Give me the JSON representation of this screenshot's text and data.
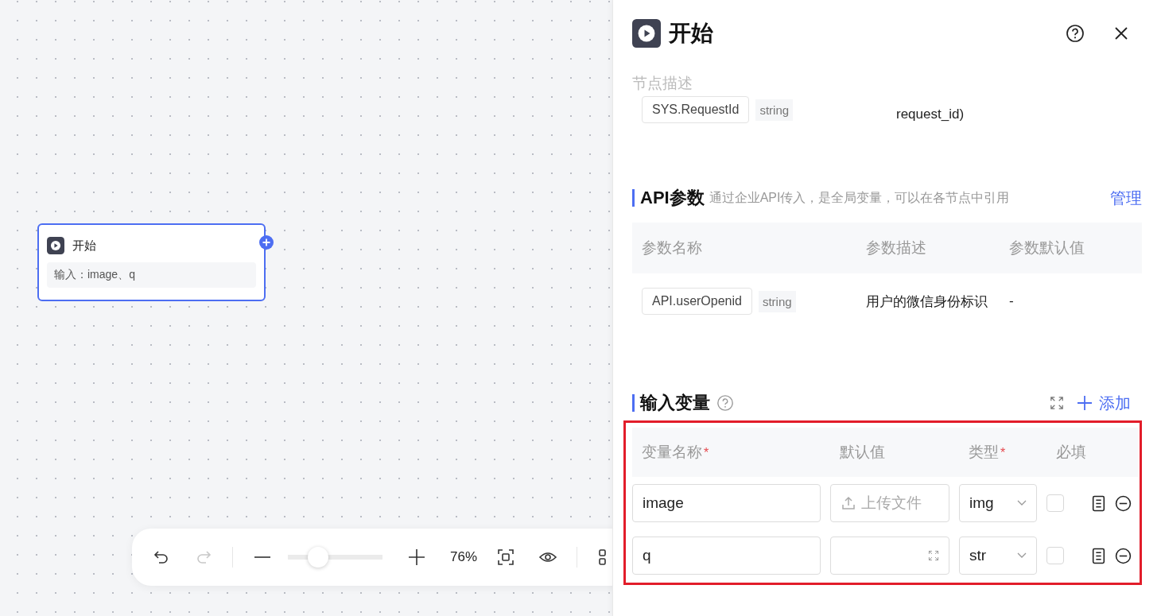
{
  "node": {
    "title": "开始",
    "summary": "输入：image、q"
  },
  "toolbar": {
    "undo_disabled": false,
    "redo_disabled": true,
    "zoom": {
      "level": 0.32
    },
    "zoom_text": "76%"
  },
  "panel": {
    "title": "开始",
    "description_label": "节点描述",
    "system_vars": [
      {
        "name": "SYS.RequestId",
        "type": "string",
        "description": "request_id)"
      }
    ],
    "api_params": {
      "title": "API参数",
      "hint": "通过企业API传入，是全局变量，可以在各节点中引用",
      "manage": "管理",
      "columns": [
        "参数名称",
        "参数描述",
        "参数默认值"
      ],
      "rows": [
        {
          "name": "API.userOpenid",
          "type": "string",
          "description": "用户的微信身份标识",
          "default": "-"
        }
      ]
    },
    "input_vars": {
      "title": "输入变量",
      "add": "添加",
      "columns": [
        {
          "label": "变量名称",
          "mark": "*"
        },
        {
          "label": "默认值"
        },
        {
          "label": "类型",
          "mark": "*"
        },
        {
          "label": "必填"
        }
      ],
      "rows": [
        {
          "name": "image",
          "kind": "upload",
          "default_placeholder": "上传文件",
          "type": "img",
          "required": false
        },
        {
          "name": "q",
          "kind": "text",
          "type": "str",
          "required": false
        }
      ]
    }
  }
}
